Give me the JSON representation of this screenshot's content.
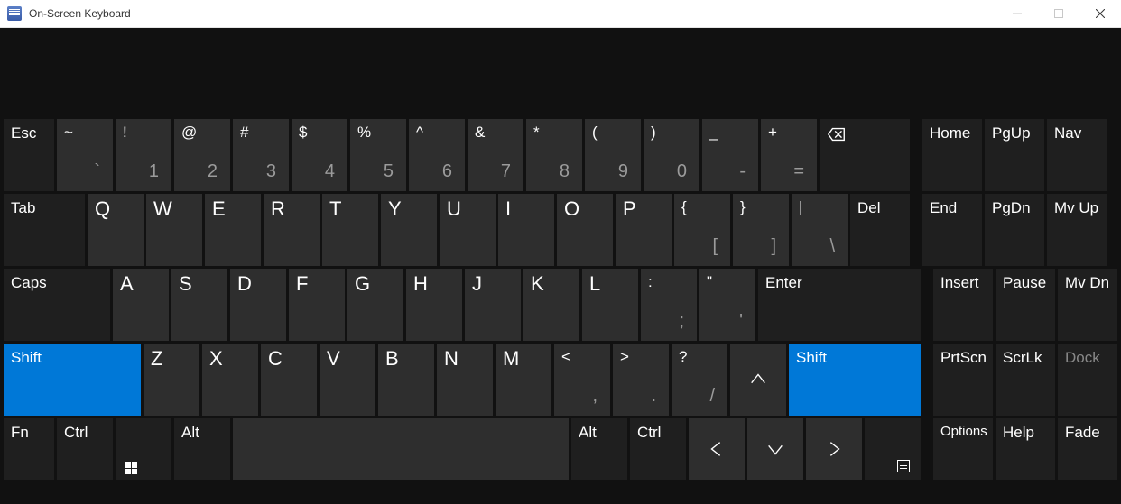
{
  "window": {
    "title": "On-Screen Keyboard"
  },
  "row1": {
    "esc": "Esc",
    "keys": [
      {
        "top": "~",
        "sub": "`"
      },
      {
        "top": "!",
        "sub": "1"
      },
      {
        "top": "@",
        "sub": "2"
      },
      {
        "top": "#",
        "sub": "3"
      },
      {
        "top": "$",
        "sub": "4"
      },
      {
        "top": "%",
        "sub": "5"
      },
      {
        "top": "^",
        "sub": "6"
      },
      {
        "top": "&",
        "sub": "7"
      },
      {
        "top": "*",
        "sub": "8"
      },
      {
        "top": "(",
        "sub": "9"
      },
      {
        "top": ")",
        "sub": "0"
      },
      {
        "top": "_",
        "sub": "-"
      },
      {
        "top": "+",
        "sub": "="
      }
    ],
    "backspace_icon": "backspace-icon"
  },
  "row2": {
    "tab": "Tab",
    "letters": [
      "Q",
      "W",
      "E",
      "R",
      "T",
      "Y",
      "U",
      "I",
      "O",
      "P"
    ],
    "brackets": [
      {
        "top": "{",
        "sub": "["
      },
      {
        "top": "}",
        "sub": "]"
      },
      {
        "top": "|",
        "sub": "\\"
      }
    ],
    "del": "Del"
  },
  "row3": {
    "caps": "Caps",
    "letters": [
      "A",
      "S",
      "D",
      "F",
      "G",
      "H",
      "J",
      "K",
      "L"
    ],
    "punct": [
      {
        "top": ":",
        "sub": ";"
      },
      {
        "top": "\"",
        "sub": "'"
      }
    ],
    "enter": "Enter"
  },
  "row4": {
    "shiftL": "Shift",
    "letters": [
      "Z",
      "X",
      "C",
      "V",
      "B",
      "N",
      "M"
    ],
    "punct": [
      {
        "top": "<",
        "sub": ","
      },
      {
        "top": ">",
        "sub": "."
      },
      {
        "top": "?",
        "sub": "/"
      }
    ],
    "up_icon": "arrow-up-icon",
    "shiftR": "Shift"
  },
  "row5": {
    "fn": "Fn",
    "ctrlL": "Ctrl",
    "win_icon": "windows-icon",
    "altL": "Alt",
    "altR": "Alt",
    "ctrlR": "Ctrl",
    "left_icon": "arrow-left-icon",
    "down_icon": "arrow-down-icon",
    "right_icon": "arrow-right-icon",
    "menu_icon": "menu-icon"
  },
  "side": {
    "r1": [
      "Home",
      "PgUp",
      "Nav"
    ],
    "r2": [
      "End",
      "PgDn",
      "Mv Up"
    ],
    "r3": [
      "Insert",
      "Pause",
      "Mv Dn"
    ],
    "r4": [
      "PrtScn",
      "ScrLk",
      "Dock"
    ],
    "r5": [
      "Options",
      "Help",
      "Fade"
    ]
  }
}
